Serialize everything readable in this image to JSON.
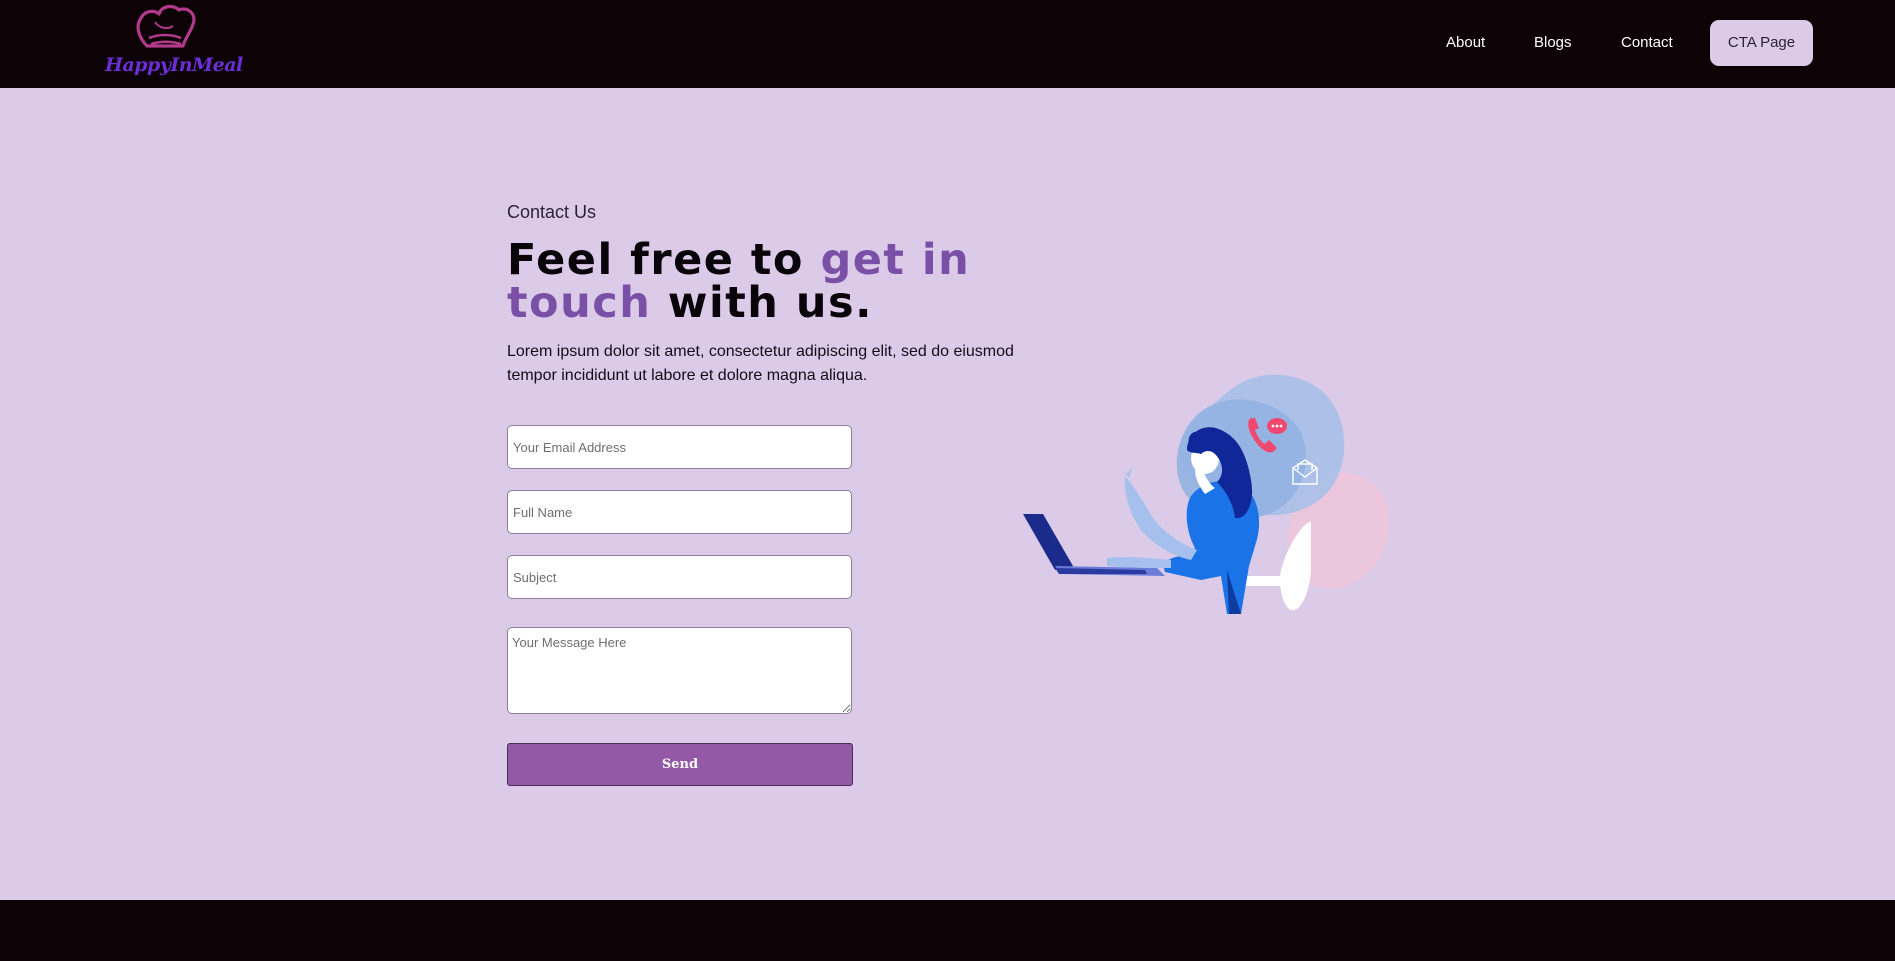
{
  "brand": {
    "name": "HappyInMeal",
    "logo_color": "#6b2fd6",
    "hat_color": "#b23a8a"
  },
  "nav": {
    "items": [
      {
        "label": "About"
      },
      {
        "label": "Blogs"
      },
      {
        "label": "Contact"
      }
    ],
    "cta_label": "CTA Page"
  },
  "contact": {
    "eyebrow": "Contact Us",
    "headline": {
      "part1": "Feel free to ",
      "accent": "get in touch",
      "part2": " with us."
    },
    "lead": "Lorem ipsum dolor sit amet, consectetur adipiscing elit, sed do eiusmod tempor incididunt ut labore et dolore magna aliqua.",
    "form": {
      "email_placeholder": "Your Email Address",
      "name_placeholder": "Full Name",
      "subject_placeholder": "Subject",
      "message_placeholder": "Your Message Here",
      "send_label": "Send"
    }
  },
  "colors": {
    "page_bg": "#dccbe8",
    "nav_bg": "#0d0206",
    "accent": "#7a4fa6",
    "button": "#9459a6"
  },
  "icons": {
    "illustration": "woman-with-laptop-contact-illustration",
    "phone": "phone-chat-icon",
    "mail": "open-envelope-icon"
  }
}
